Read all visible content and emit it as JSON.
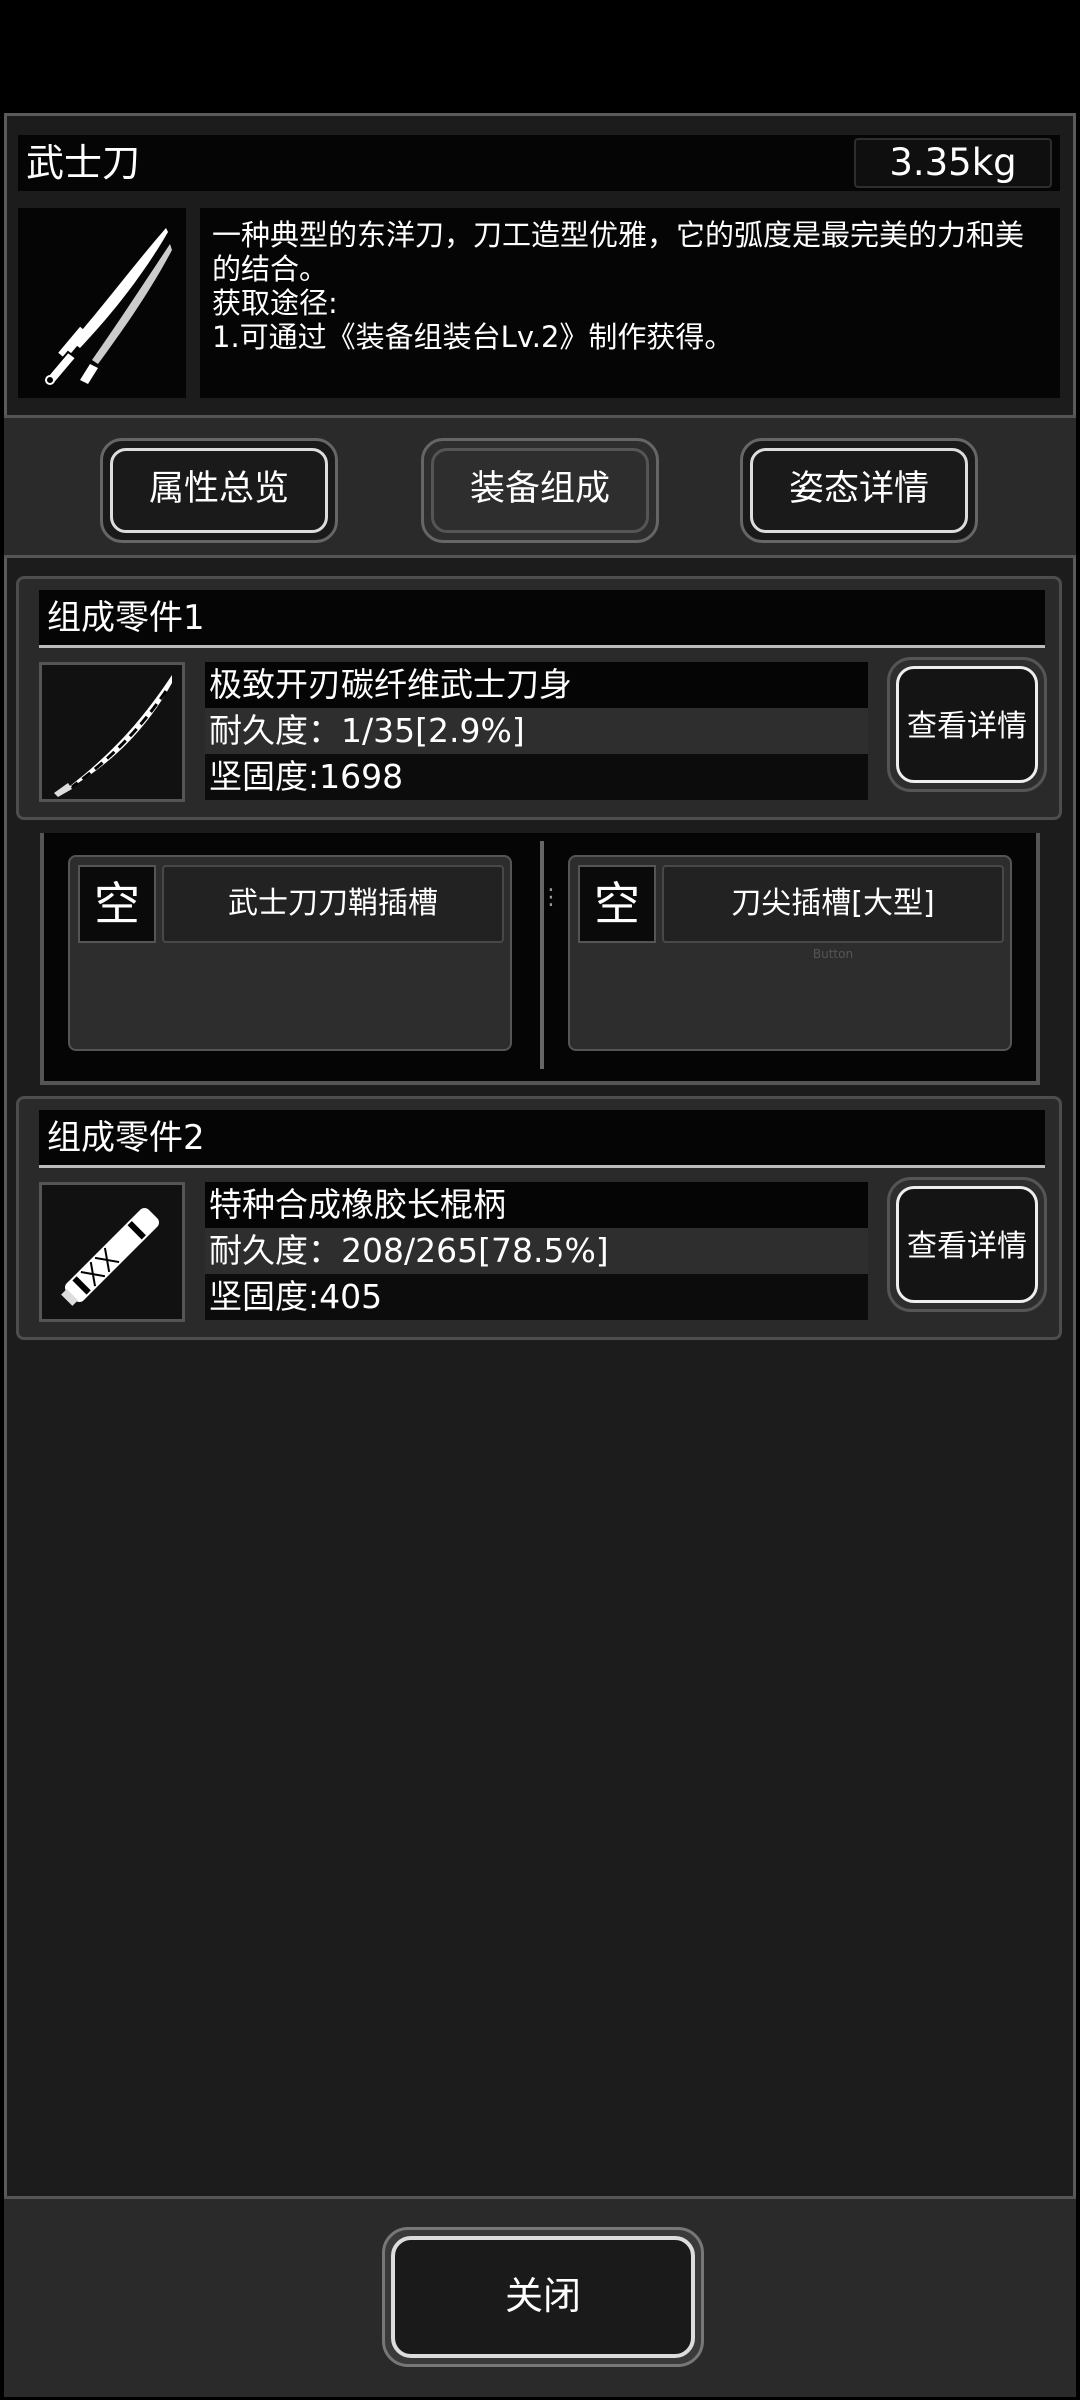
{
  "item": {
    "name": "武士刀",
    "weight": "3.35kg",
    "description_lines": [
      "一种典型的东洋刀，刀工造型优雅，它的弧度是最完美的力和美",
      "的结合。",
      "获取途径:",
      "1.可通过《装备组装台Lv.2》制作获得。"
    ]
  },
  "tabs": [
    {
      "label": "属性总览",
      "active": false
    },
    {
      "label": "装备组成",
      "active": true
    },
    {
      "label": "姿态详情",
      "active": false
    }
  ],
  "parts": [
    {
      "header": "组成零件1",
      "name": "极致开刃碳纤维武士刀身",
      "durability": "耐久度：1/35[2.9%]",
      "firmness": "坚固度:1698",
      "button": "查看详情",
      "icon": "blade-icon"
    },
    {
      "header": "组成零件2",
      "name": "特种合成橡胶长棍柄",
      "durability": "耐久度：208/265[78.5%]",
      "firmness": "坚固度:405",
      "button": "查看详情",
      "icon": "handle-icon"
    }
  ],
  "slots": [
    {
      "status": "空",
      "name": "武士刀刀鞘插槽",
      "ghost": ""
    },
    {
      "status": "空",
      "name": "刀尖插槽[大型]",
      "ghost": "Button"
    }
  ],
  "footer": {
    "close_label": "关闭"
  },
  "colors": {
    "background": "#1c1c1c",
    "panel_dark": "#050505",
    "text": "#ffffff"
  }
}
